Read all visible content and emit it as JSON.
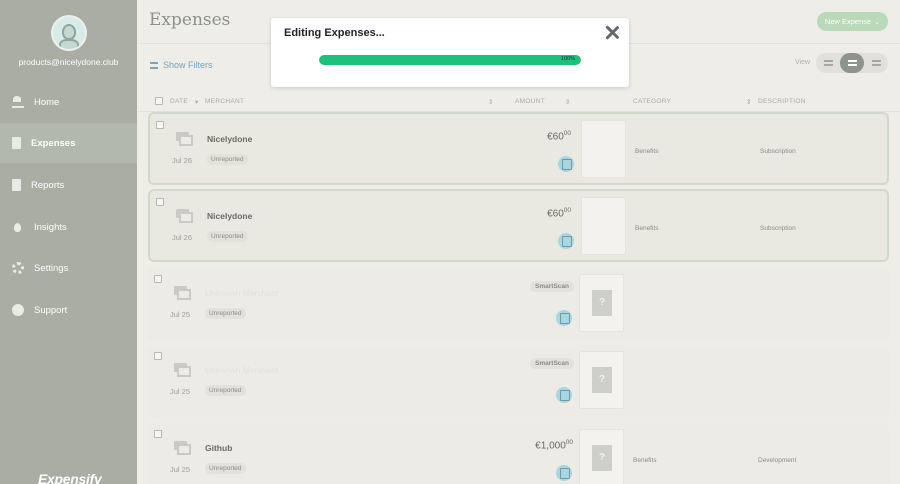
{
  "sidebar": {
    "email": "products@nicelydone.club",
    "items": [
      {
        "label": "Home",
        "icon": "home-icon"
      },
      {
        "label": "Expenses",
        "icon": "document-icon",
        "active": true
      },
      {
        "label": "Reports",
        "icon": "file-icon"
      },
      {
        "label": "Insights",
        "icon": "lightbulb-icon"
      },
      {
        "label": "Settings",
        "icon": "gear-icon"
      },
      {
        "label": "Support",
        "icon": "chat-icon"
      }
    ],
    "logo": "Expensify"
  },
  "header": {
    "title": "Expenses",
    "new_button": "New Expense"
  },
  "toolbar": {
    "filters_label": "Show Filters",
    "view_label": "View"
  },
  "table": {
    "columns": [
      "DATE",
      "MERCHANT",
      "AMOUNT",
      "CATEGORY",
      "DESCRIPTION"
    ],
    "rows": [
      {
        "date": "Jul 26",
        "merchant": "Nicelydone",
        "status": "Unreported",
        "currency": "€",
        "amount": "60",
        "cents": "00",
        "category": "Benefits",
        "description": "Subscription"
      },
      {
        "date": "Jul 26",
        "merchant": "Nicelydone",
        "status": "Unreported",
        "currency": "€",
        "amount": "60",
        "cents": "00",
        "category": "Benefits",
        "description": "Subscription"
      },
      {
        "date": "Jul 25",
        "merchant": "Unknown Merchant",
        "status": "Unreported",
        "smartscan": "SmartScan",
        "category": "",
        "description": ""
      },
      {
        "date": "Jul 25",
        "merchant": "Unknown Merchant",
        "status": "Unreported",
        "smartscan": "SmartScan",
        "category": "",
        "description": ""
      },
      {
        "date": "Jul 25",
        "merchant": "Github",
        "status": "Unreported",
        "currency": "€",
        "amount": "1,000",
        "cents": "00",
        "category": "Benefits",
        "description": "Development"
      }
    ]
  },
  "modal": {
    "title": "Editing Expenses...",
    "progress_pct": 100,
    "progress_label": "100%"
  },
  "colors": {
    "sidebar": "#a9ada4",
    "progress": "#1cc17a",
    "accent_button": "#b9d9b8"
  }
}
